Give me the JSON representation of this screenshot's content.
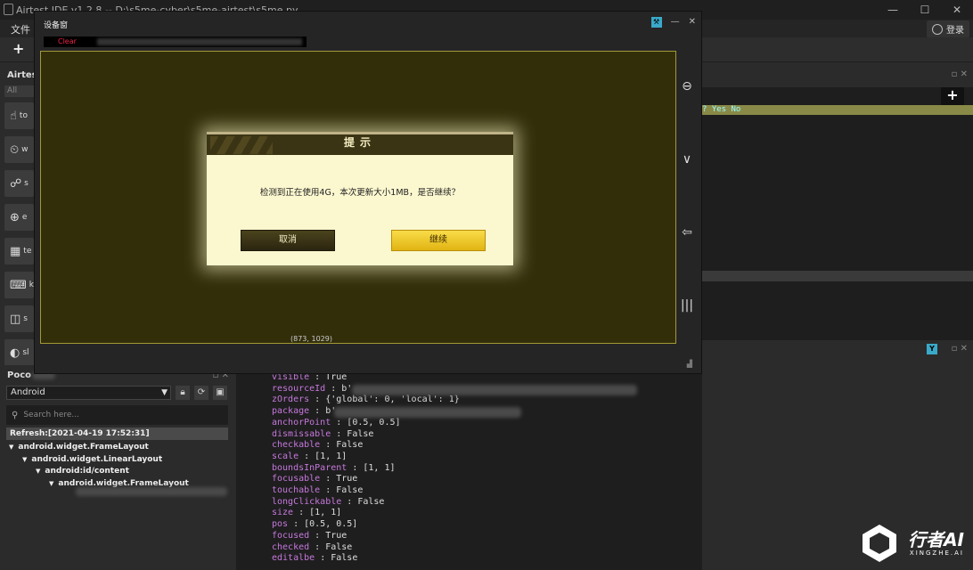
{
  "app": {
    "title": "Airtest IDE v1.2.8 -- D:\\s5me-cyber\\s5me-airtest\\s5me.py",
    "menu_file": "文件",
    "login_label": "登录",
    "window_controls": [
      "—",
      "☐",
      "✕"
    ]
  },
  "toolbar": {
    "new_label": "+"
  },
  "airtest_panel": {
    "title": "Airtes",
    "filter_value": "All",
    "buttons": [
      {
        "icon": "touch-icon",
        "glyph": "☝",
        "label": "to"
      },
      {
        "icon": "wait-icon",
        "glyph": "⏲",
        "label": "w"
      },
      {
        "icon": "swipe-icon",
        "glyph": "☍",
        "label": "s"
      },
      {
        "icon": "exists-icon",
        "glyph": "⊕",
        "label": "e"
      },
      {
        "icon": "text-icon",
        "glyph": "▦",
        "label": "te"
      },
      {
        "icon": "keyevent-icon",
        "glyph": "⌨",
        "label": "k"
      },
      {
        "icon": "snapshot-icon",
        "glyph": "◫",
        "label": "s"
      },
      {
        "icon": "sleep-icon",
        "glyph": "◐",
        "label": "sl"
      }
    ]
  },
  "device_window": {
    "title": "设备窗",
    "clear_label": "Clear",
    "coordinate": "(873, 1029)",
    "dialog": {
      "title": "提示",
      "message": "检测到正在使用4G，本次更新大小1MB，是否继续？",
      "cancel": "取消",
      "continue": "继续"
    }
  },
  "right_panel": {
    "add_label": "+",
    "yesno_text": "? Yes No",
    "filter_label": "Y"
  },
  "poco": {
    "title": "Poco",
    "platform": "Android",
    "search_placeholder": "Search here...",
    "refresh": "Refresh:[2021-04-19 17:52:31]",
    "tree": [
      {
        "label": "android.widget.FrameLayout",
        "depth": 0
      },
      {
        "label": "android.widget.LinearLayout",
        "depth": 1
      },
      {
        "label": "android:id/content",
        "depth": 2
      },
      {
        "label": "android.widget.FrameLayout",
        "depth": 3
      }
    ]
  },
  "inspector": {
    "properties": [
      {
        "key": "visible",
        "value": "True"
      },
      {
        "key": "resourceId",
        "value": "b'"
      },
      {
        "key": "zOrders",
        "value": "{'global': 0, 'local': 1}"
      },
      {
        "key": "package",
        "value": "b'"
      },
      {
        "key": "anchorPoint",
        "value": "[0.5, 0.5]"
      },
      {
        "key": "dismissable",
        "value": "False"
      },
      {
        "key": "checkable",
        "value": "False"
      },
      {
        "key": "scale",
        "value": "[1, 1]"
      },
      {
        "key": "boundsInParent",
        "value": "[1, 1]"
      },
      {
        "key": "focusable",
        "value": "True"
      },
      {
        "key": "touchable",
        "value": "False"
      },
      {
        "key": "longClickable",
        "value": "False"
      },
      {
        "key": "size",
        "value": "[1, 1]"
      },
      {
        "key": "pos",
        "value": "[0.5, 0.5]"
      },
      {
        "key": "focused",
        "value": "True"
      },
      {
        "key": "checked",
        "value": "False"
      },
      {
        "key": "editalbe",
        "value": "False"
      }
    ]
  },
  "watermark": {
    "brand": "行者AI",
    "sub": "XINGZHE.AI"
  }
}
